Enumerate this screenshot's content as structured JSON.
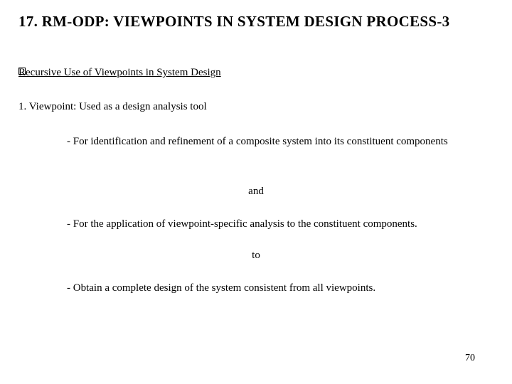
{
  "title": "17. RM-ODP: VIEWPOINTS IN SYSTEM DESIGN PROCESS-3",
  "subheading": "Recursive Use of Viewpoints in System Design",
  "line1": "1. Viewpoint: Used as a design analysis tool",
  "bullet1": "- For identification and refinement of a composite system into its constituent components",
  "connector1": "and",
  "bullet2": "- For the application of viewpoint-specific analysis to the constituent components.",
  "connector2": "to",
  "bullet3": "- Obtain a complete design of the system consistent from all viewpoints.",
  "page_number": "70"
}
